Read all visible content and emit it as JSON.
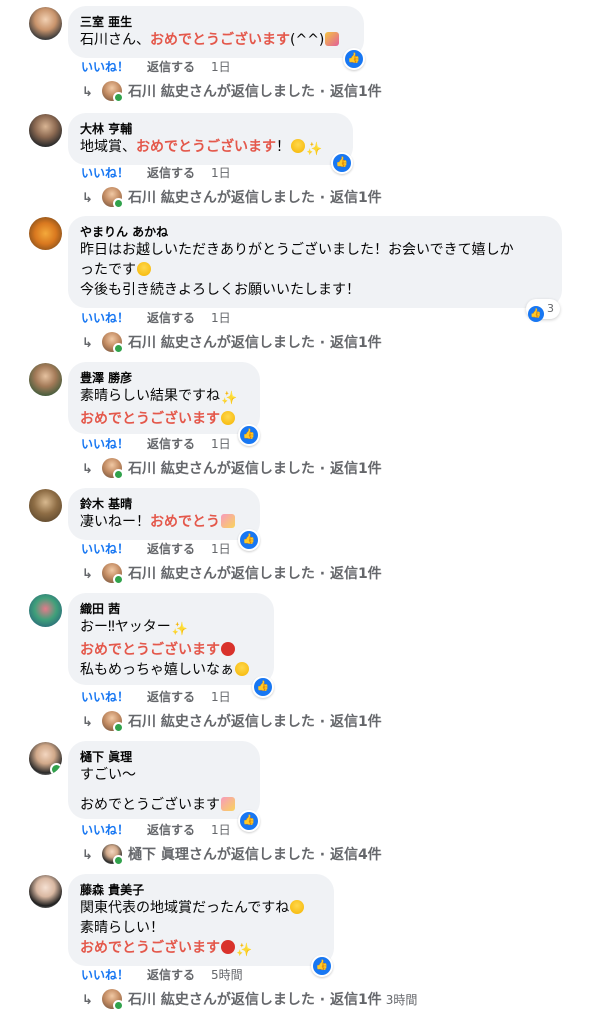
{
  "comments": [
    {
      "author": "三室 亜生",
      "lines": [
        [
          {
            "t": "石川さん、",
            "h": false
          },
          {
            "t": "おめでとうございます",
            "h": true
          },
          {
            "t": "(^^)",
            "h": false
          }
        ]
      ],
      "emoji": [
        "party"
      ],
      "like_label": "いいね！",
      "reply_label": "返信する",
      "time": "1日",
      "reply_summary": "石川 紘史さんが返信しました · 返信1件",
      "reply_time": "",
      "reactions": ""
    },
    {
      "author": "大林 亨輔",
      "lines": [
        [
          {
            "t": "地域賞、",
            "h": false
          },
          {
            "t": "おめでとうございます",
            "h": true
          },
          {
            "t": "！",
            "h": false
          }
        ]
      ],
      "like_label": "いいね！",
      "reply_label": "返信する",
      "time": "1日",
      "reply_summary": "石川 紘史さんが返信しました · 返信1件",
      "reply_time": "",
      "reactions": ""
    },
    {
      "author": "やまりん あかね",
      "lines": [
        [
          {
            "t": "昨日はお越しいただきありがとうございました！お会いできて嬉しか",
            "h": false
          }
        ],
        [
          {
            "t": "ったです",
            "h": false
          }
        ],
        [
          {
            "t": "今後も引き続きよろしくお願いいたします！",
            "h": false
          }
        ]
      ],
      "like_label": "いいね！",
      "reply_label": "返信する",
      "time": "1日",
      "reply_summary": "石川 紘史さんが返信しました · 返信1件",
      "reply_time": "",
      "reactions": "3"
    },
    {
      "author": "豊澤 勝彦",
      "lines": [
        [
          {
            "t": "素晴らしい結果ですね",
            "h": false
          }
        ],
        [
          {
            "t": "おめでとうございます",
            "h": true
          }
        ]
      ],
      "like_label": "いいね！",
      "reply_label": "返信する",
      "time": "1日",
      "reply_summary": "石川 紘史さんが返信しました · 返信1件",
      "reply_time": "",
      "reactions": ""
    },
    {
      "author": "鈴木 基晴",
      "lines": [
        [
          {
            "t": "凄いねー！",
            "h": false
          },
          {
            "t": "おめでとう",
            "h": true
          }
        ]
      ],
      "like_label": "いいね！",
      "reply_label": "返信する",
      "time": "1日",
      "reply_summary": "石川 紘史さんが返信しました · 返信1件",
      "reply_time": "",
      "reactions": ""
    },
    {
      "author": "織田 茜",
      "lines": [
        [
          {
            "t": "おー‼ヤッター",
            "h": false
          }
        ],
        [
          {
            "t": "おめでとうございます",
            "h": true
          }
        ],
        [
          {
            "t": "私もめっちゃ嬉しいなぁ",
            "h": false
          }
        ]
      ],
      "like_label": "いいね！",
      "reply_label": "返信する",
      "time": "1日",
      "reply_summary": "石川 紘史さんが返信しました · 返信1件",
      "reply_time": "",
      "reactions": ""
    },
    {
      "author": "樋下 眞理",
      "lines": [
        [
          {
            "t": "すごい〜",
            "h": false
          }
        ],
        [
          {
            "t": "",
            "h": false
          }
        ],
        [
          {
            "t": "おめでとうございます",
            "h": false
          }
        ]
      ],
      "like_label": "いいね！",
      "reply_label": "返信する",
      "time": "1日",
      "reply_summary": "樋下 眞理さんが返信しました · 返信4件",
      "reply_time": "",
      "reactions": ""
    },
    {
      "author": "藤森 貴美子",
      "lines": [
        [
          {
            "t": "関東代表の地域賞だったんですね",
            "h": false
          }
        ],
        [
          {
            "t": "素晴らしい！",
            "h": false
          }
        ],
        [
          {
            "t": "おめでとうございます",
            "h": true
          }
        ]
      ],
      "like_label": "いいね！",
      "reply_label": "返信する",
      "time": "5時間",
      "reply_summary": "石川 紘史さんが返信しました · 返信1件",
      "reply_time": "3時間",
      "reactions": ""
    }
  ],
  "icons": {
    "like": "thumbs-up-icon",
    "reply_arrow": "reply-arrow-icon"
  },
  "colors": {
    "highlight": "#e4584b",
    "link_blue": "#1877f2",
    "bubble": "#f0f2f5",
    "meta": "#65676b",
    "online": "#31a24c"
  }
}
